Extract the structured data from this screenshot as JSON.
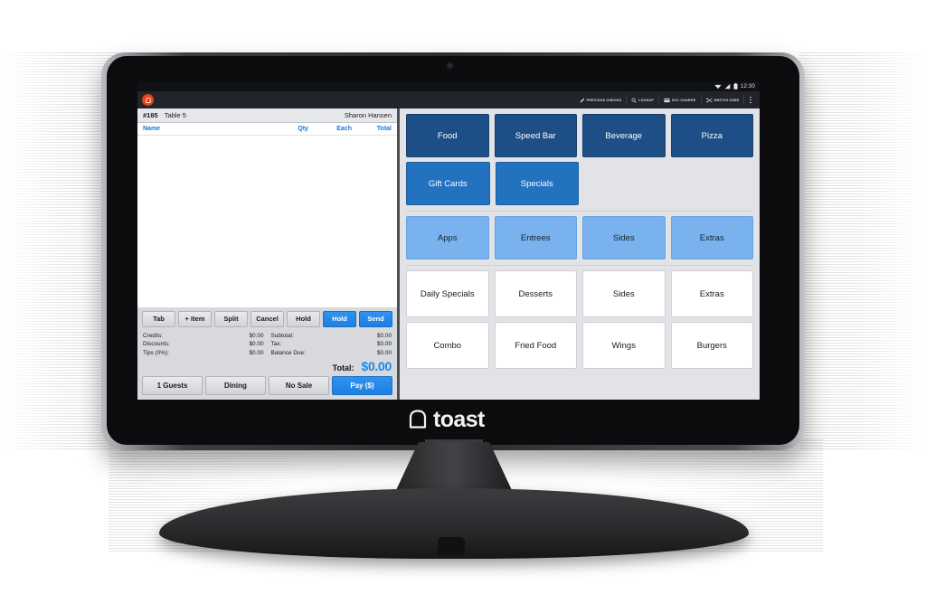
{
  "device": {
    "brand_wordmark": "toast",
    "brand_icon": "toast-bread-logo-icon",
    "camera": "webcam-dot-icon",
    "stand": "monitor-stand"
  },
  "statusbar": {
    "wifi_icon": "wifi-icon",
    "signal_icon": "cell-signal-icon",
    "battery_icon": "battery-icon",
    "clock": "12:30"
  },
  "appbar": {
    "app_icon": "toast-app-icon",
    "actions": [
      {
        "label": "PREVIOUS CHECKS",
        "icon": "pencil-icon"
      },
      {
        "label": "LOOKUP",
        "icon": "search-icon"
      },
      {
        "label": "SVC CHARGE",
        "icon": "card-swipe-icon"
      },
      {
        "label": "SWITCH USER",
        "icon": "switch-user-icon"
      }
    ],
    "overflow_icon": "kebab-menu-icon"
  },
  "check": {
    "number": "#185",
    "table": "Table 5",
    "server": "Sharon Hansen",
    "columns": {
      "name": "Name",
      "qty": "Qty",
      "each": "Each",
      "total": "Total"
    },
    "items": [],
    "actions": [
      {
        "label": "Tab",
        "style": "gray"
      },
      {
        "label": "+ Item",
        "style": "gray"
      },
      {
        "label": "Split",
        "style": "gray"
      },
      {
        "label": "Cancel",
        "style": "gray"
      },
      {
        "label": "Hold",
        "style": "gray"
      },
      {
        "label": "Hold",
        "style": "blue"
      },
      {
        "label": "Send",
        "style": "blue"
      }
    ],
    "totals_left": [
      {
        "label": "Credits:",
        "value": "$0.00"
      },
      {
        "label": "Discounts:",
        "value": "$0.00"
      },
      {
        "label": "Tips (0%):",
        "value": "$0.00"
      }
    ],
    "totals_right": [
      {
        "label": "Subtotal:",
        "value": "$0.00"
      },
      {
        "label": "Tax:",
        "value": "$0.00"
      },
      {
        "label": "Balance Due:",
        "value": "$0.00"
      }
    ],
    "grand_total": {
      "label": "Total:",
      "value": "$0.00"
    },
    "bottom_actions": [
      {
        "label": "1 Guests",
        "style": "gray"
      },
      {
        "label": "Dining",
        "style": "gray"
      },
      {
        "label": "No Sale",
        "style": "gray"
      },
      {
        "label": "Pay ($)",
        "style": "blue"
      }
    ]
  },
  "menu": {
    "row1": [
      {
        "label": "Food",
        "style": "darkblue"
      },
      {
        "label": "Speed Bar",
        "style": "darkblue"
      },
      {
        "label": "Beverage",
        "style": "darkblue"
      },
      {
        "label": "Pizza",
        "style": "darkblue"
      }
    ],
    "row2": [
      {
        "label": "Gift Cards",
        "style": "midblue"
      },
      {
        "label": "Specials",
        "style": "midblue"
      },
      {
        "label": "",
        "style": "empty"
      },
      {
        "label": "",
        "style": "empty"
      }
    ],
    "row3": [
      {
        "label": "Apps",
        "style": "lightblue"
      },
      {
        "label": "Entrees",
        "style": "lightblue"
      },
      {
        "label": "Sides",
        "style": "lightblue"
      },
      {
        "label": "Extras",
        "style": "lightblue"
      }
    ],
    "row4": [
      {
        "label": "Daily Specials",
        "style": "white"
      },
      {
        "label": "Desserts",
        "style": "white"
      },
      {
        "label": "Sides",
        "style": "white"
      },
      {
        "label": "Extras",
        "style": "white"
      }
    ],
    "row5": [
      {
        "label": "Combo",
        "style": "white"
      },
      {
        "label": "Fried Food",
        "style": "white"
      },
      {
        "label": "Wings",
        "style": "white"
      },
      {
        "label": "Burgers",
        "style": "white"
      }
    ]
  },
  "colors": {
    "accent_blue": "#1b86f0",
    "tile_dark_blue": "#1d4e85",
    "tile_mid_blue": "#2272bf",
    "tile_light_blue": "#79b2ee",
    "brand_orange": "#ec3f18",
    "appbar_dark": "#22242b"
  }
}
